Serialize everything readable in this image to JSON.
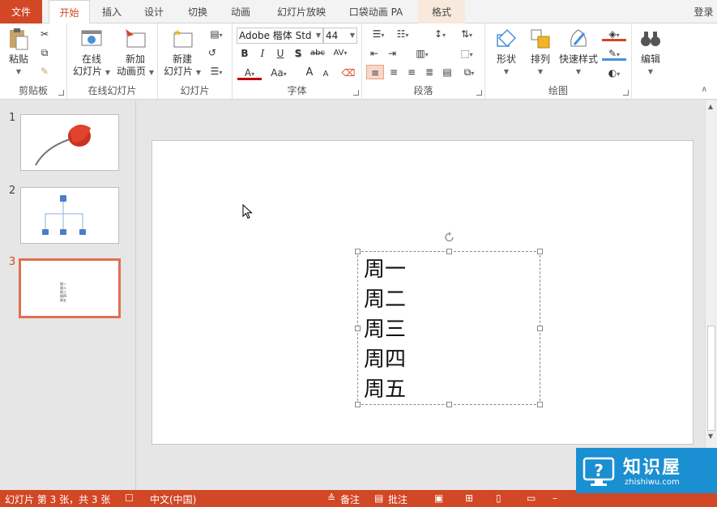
{
  "tabs": {
    "file": "文件",
    "home": "开始",
    "insert": "插入",
    "design": "设计",
    "transitions": "切换",
    "animations": "动画",
    "slideshow": "幻灯片放映",
    "pocket": "口袋动画 PA",
    "format": "格式",
    "login": "登录"
  },
  "ribbon": {
    "clipboard": {
      "label": "剪贴板",
      "paste": "粘贴"
    },
    "online": {
      "label": "在线幻灯片",
      "online_slide": "在线\n幻灯片",
      "online_slide_a": "在线",
      "online_slide_b": "幻灯片",
      "new_anim_a": "新加",
      "new_anim_b": "动画页"
    },
    "slides": {
      "label": "幻灯片",
      "new_slide_a": "新建",
      "new_slide_b": "幻灯片"
    },
    "font": {
      "label": "字体",
      "font_name": "Adobe 楷体 Std",
      "font_size": "44",
      "bold": "B",
      "italic": "I",
      "underline": "U",
      "shadow": "S",
      "strike": "abc",
      "spacing": "AV",
      "color": "A",
      "case": "Aa",
      "grow": "A",
      "shrink": "A"
    },
    "paragraph": {
      "label": "段落"
    },
    "drawing": {
      "label": "绘图",
      "shapes": "形状",
      "arrange": "排列",
      "quick_styles": "快速样式"
    },
    "editing": {
      "label": "编辑"
    }
  },
  "thumbnails": [
    {
      "num": "1"
    },
    {
      "num": "2"
    },
    {
      "num": "3"
    }
  ],
  "thumb3_lines": [
    "周一",
    "周二",
    "周三",
    "周四",
    "周五"
  ],
  "slide": {
    "lines": [
      "周一",
      "周二",
      "周三",
      "周四",
      "周五"
    ]
  },
  "status": {
    "slide_info": "幻灯片 第 3 张，共 3 张",
    "language": "中文(中国)",
    "notes": "备注",
    "comments": "批注"
  },
  "watermark": {
    "brand": "知识屋",
    "url": "zhishiwu.com"
  },
  "colors": {
    "accent": "#d24726",
    "watermark": "#1a8fd1"
  }
}
